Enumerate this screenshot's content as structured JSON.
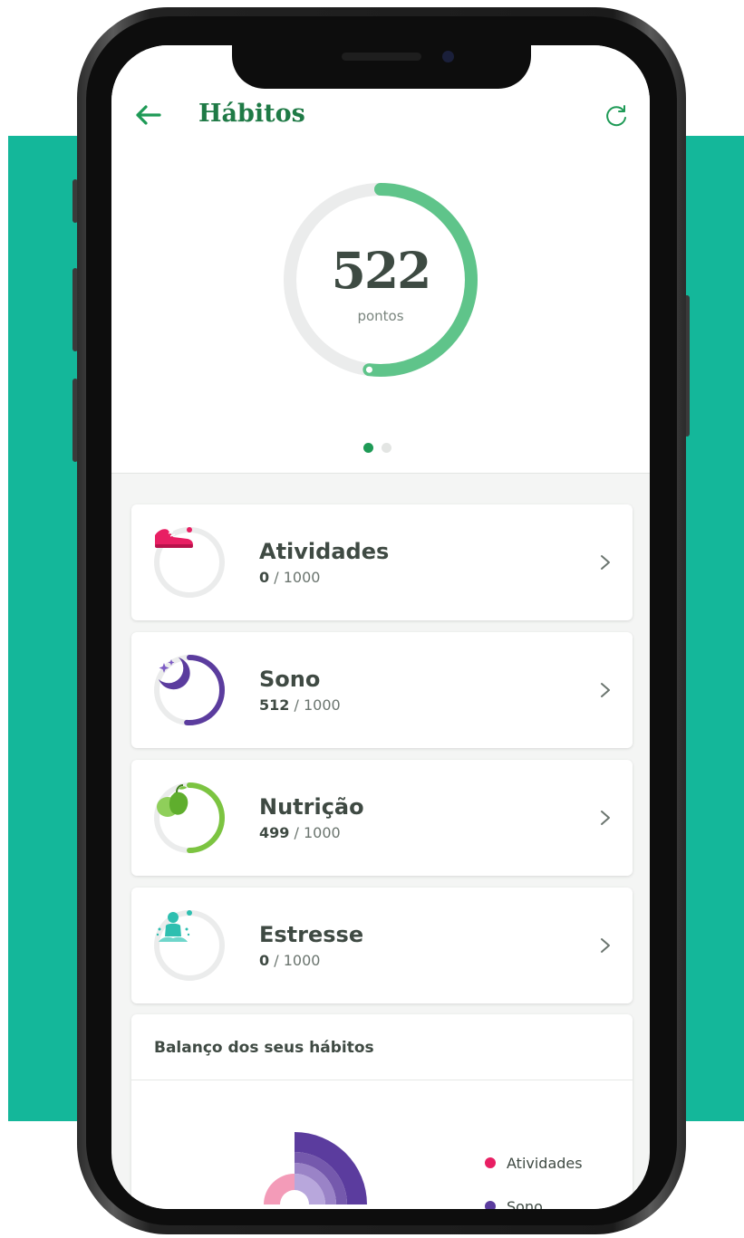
{
  "header": {
    "title": "Hábitos"
  },
  "gauge": {
    "value": "522",
    "unit": "pontos",
    "fraction": 0.52
  },
  "pager": {
    "count": 2,
    "active": 0
  },
  "habits": [
    {
      "name": "Atividades",
      "current": "0",
      "max": "/ 1000",
      "fraction": 0,
      "color": "#e81f63",
      "icon": "sneaker-icon"
    },
    {
      "name": "Sono",
      "current": "512",
      "max": "/ 1000",
      "fraction": 0.512,
      "color": "#5b3c9e",
      "icon": "moon-stars-icon"
    },
    {
      "name": "Nutrição",
      "current": "499",
      "max": "/ 1000",
      "fraction": 0.499,
      "color": "#7cc441",
      "icon": "apple-icon"
    },
    {
      "name": "Estresse",
      "current": "0",
      "max": "/ 1000",
      "fraction": 0,
      "color": "#2ebfb0",
      "icon": "meditation-icon"
    }
  ],
  "balance": {
    "title": "Balanço dos seus hábitos",
    "legend": [
      {
        "label": "Atividades",
        "color": "#e81f63"
      },
      {
        "label": "Sono",
        "color": "#5b3c9e"
      }
    ]
  },
  "colors": {
    "brand_green": "#1f7a46",
    "teal_background": "#14b79a",
    "gauge_green": "#5fc48a"
  }
}
